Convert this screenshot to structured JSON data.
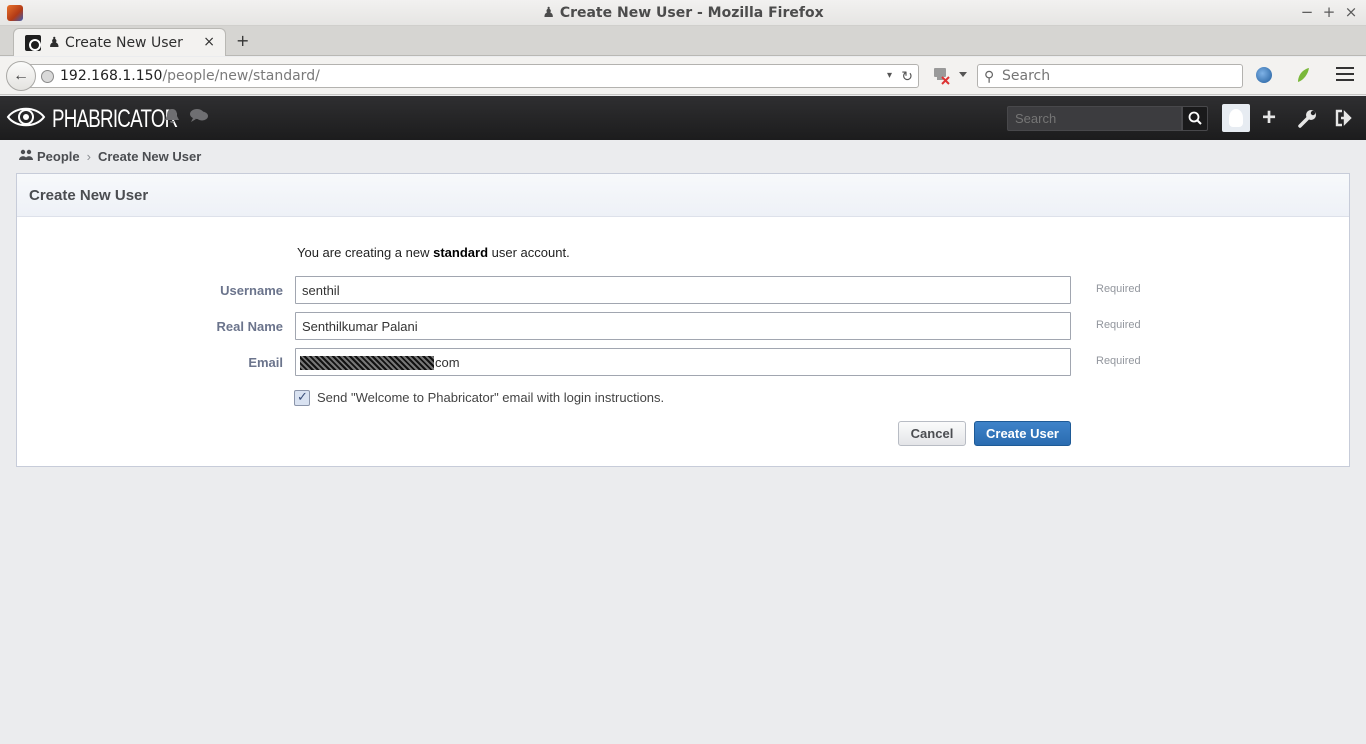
{
  "window": {
    "title": "♟ Create New User - Mozilla Firefox",
    "min_glyph": "−",
    "max_glyph": "+",
    "close_glyph": "×"
  },
  "tabs": [
    {
      "label": "♟ Create New User",
      "close_glyph": "×"
    }
  ],
  "new_tab_glyph": "+",
  "navbar": {
    "back_glyph": "←",
    "url_host": "192.168.1.150",
    "url_path": "/people/new/standard/",
    "dropdown_glyph": "▾",
    "reload_glyph": "↻",
    "search_placeholder": "Search",
    "search_glyph": "⚲"
  },
  "phab": {
    "brand": "PHABRICATOR",
    "search_placeholder": "Search",
    "bell_glyph": "🔔",
    "chat_glyph": "💬",
    "plus_glyph": "+",
    "wrench_glyph": "🔧",
    "logout_glyph": "⇥"
  },
  "crumbs": {
    "people_icon_glyph": "👥",
    "people": "People",
    "separator": "›",
    "current": "Create New User"
  },
  "panel": {
    "title": "Create New User",
    "intro_prefix": "You are creating a new ",
    "intro_bold": "standard",
    "intro_suffix": " user account."
  },
  "form": {
    "username_label": "Username",
    "username_value": "senthil",
    "realname_label": "Real Name",
    "realname_value": "Senthilkumar Palani",
    "email_label": "Email",
    "email_visible_suffix": "com",
    "required_text": "Required",
    "welcome_checkbox_label": "Send \"Welcome to Phabricator\" email with login instructions.",
    "welcome_checked": true,
    "cancel_label": "Cancel",
    "submit_label": "Create User"
  },
  "colors": {
    "header_bg": "#1c1c1d",
    "primary_button": "#2a6cb0",
    "label_color": "#6b748c"
  }
}
